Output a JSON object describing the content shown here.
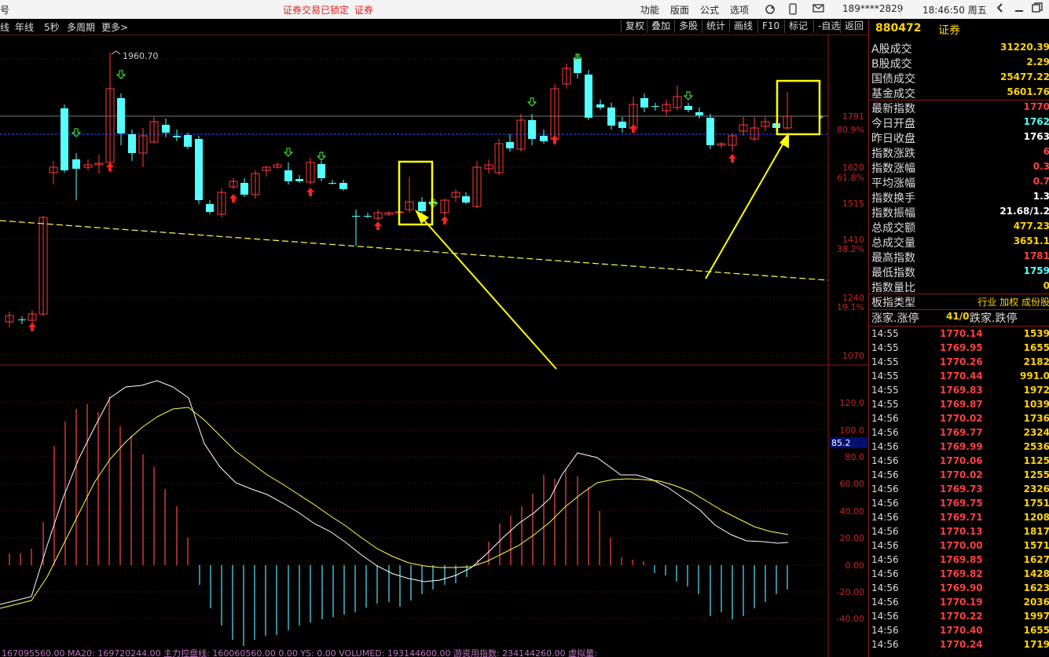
{
  "titlebar": {
    "left_glyph": "号",
    "lock_text": "证券交易已锁定",
    "lock_link": "证券",
    "menu": [
      "功能",
      "版面",
      "公式",
      "选项"
    ],
    "phone": "189****2829",
    "clock": "18:46:50 周五"
  },
  "toolbar": {
    "left": [
      "线",
      "年线",
      "5秒",
      "多周期",
      "更多>"
    ],
    "right": [
      "复权",
      "叠加",
      "多股",
      "统计",
      "画线",
      "F10",
      "标记",
      "-自选",
      "返回"
    ]
  },
  "chart": {
    "peak_label": "1960.70",
    "price_axis": [
      "1791",
      "80.9%",
      "1620",
      "61.8%",
      "1515",
      "1410",
      "38.2%",
      "1240",
      "19.1%",
      "1070"
    ],
    "macd_axis": [
      "120.0",
      "100.0",
      "80.0",
      "60.00",
      "40.00",
      "20.00",
      "0.00",
      "-20.00",
      "-40.00"
    ],
    "macd_cursor_value": "85.2",
    "status_bar": "167095560.00  MA20: 169720244.00  主力控盘线: 160060560.00  0.00  YS: 0.00  VOLUMED: 193144600.00  游资用指数: 234144260.00  虚拟量:",
    "colors": {
      "up": "#ff3a3a",
      "down": "#54ffff",
      "macd_fast": "#ffffff",
      "macd_slow": "#ffff50",
      "highlight": "#ffff00"
    }
  },
  "panel": {
    "code": "880472",
    "name": "证券",
    "stats": [
      {
        "label": "A股成交",
        "value": "31220.39",
        "color": "#ffd400"
      },
      {
        "label": "B股成交",
        "value": "2.29",
        "color": "#ffd400"
      },
      {
        "label": "国债成交",
        "value": "25477.22",
        "color": "#ffd400"
      },
      {
        "label": "基金成交",
        "value": "5601.76",
        "color": "#ffd400"
      },
      {
        "label": "最新指数",
        "value": "1770",
        "color": "#ff4040"
      },
      {
        "label": "今日开盘",
        "value": "1762",
        "color": "#54ffff"
      },
      {
        "label": "昨日收盘",
        "value": "1763",
        "color": "#ffffff"
      },
      {
        "label": "指数涨跌",
        "value": "6",
        "color": "#ff4040"
      },
      {
        "label": "指数涨幅",
        "value": "0.3",
        "color": "#ff4040"
      },
      {
        "label": "平均涨幅",
        "value": "0.7",
        "color": "#ff4040"
      },
      {
        "label": "指数换手",
        "value": "1.3",
        "color": "#ffffff"
      },
      {
        "label": "指数振幅",
        "value": "21.68/1.2",
        "color": "#ffffff"
      },
      {
        "label": "总成交额",
        "value": "477.23",
        "color": "#ffd400"
      },
      {
        "label": "总成交量",
        "value": "3651.1",
        "color": "#ffd400"
      },
      {
        "label": "最高指数",
        "value": "1781",
        "color": "#ff4040"
      },
      {
        "label": "最低指数",
        "value": "1759",
        "color": "#54ffff"
      },
      {
        "label": "指数量比",
        "value": "0",
        "color": "#ffd400"
      }
    ],
    "board_type_label": "板指类型",
    "board_type_value": "行业 加权 成份股",
    "updown_label": "涨家.涨停",
    "updown_value": "41/0",
    "down_label": "跌家.跌停",
    "ticks": [
      {
        "time": "14:55",
        "price": "1770.14",
        "vol": "1539"
      },
      {
        "time": "14:55",
        "price": "1769.95",
        "vol": "1655"
      },
      {
        "time": "14:55",
        "price": "1770.26",
        "vol": "2182"
      },
      {
        "time": "14:55",
        "price": "1770.44",
        "vol": "991.0"
      },
      {
        "time": "14:55",
        "price": "1769.83",
        "vol": "1972"
      },
      {
        "time": "14:55",
        "price": "1769.87",
        "vol": "1039"
      },
      {
        "time": "14:56",
        "price": "1770.02",
        "vol": "1736"
      },
      {
        "time": "14:56",
        "price": "1769.77",
        "vol": "2324"
      },
      {
        "time": "14:56",
        "price": "1769.99",
        "vol": "2536"
      },
      {
        "time": "14:56",
        "price": "1770.06",
        "vol": "1125"
      },
      {
        "time": "14:56",
        "price": "1770.02",
        "vol": "1255"
      },
      {
        "time": "14:56",
        "price": "1769.73",
        "vol": "2326"
      },
      {
        "time": "14:56",
        "price": "1769.75",
        "vol": "1751"
      },
      {
        "time": "14:56",
        "price": "1769.71",
        "vol": "1208"
      },
      {
        "time": "14:56",
        "price": "1770.13",
        "vol": "1817"
      },
      {
        "time": "14:56",
        "price": "1770.00",
        "vol": "1571"
      },
      {
        "time": "14:56",
        "price": "1769.85",
        "vol": "1627"
      },
      {
        "time": "14:56",
        "price": "1769.82",
        "vol": "1428"
      },
      {
        "time": "14:56",
        "price": "1769.90",
        "vol": "1623"
      },
      {
        "time": "14:56",
        "price": "1770.19",
        "vol": "2036"
      },
      {
        "time": "14:56",
        "price": "1770.22",
        "vol": "1997"
      },
      {
        "time": "14:56",
        "price": "1770.40",
        "vol": "1655"
      },
      {
        "time": "14:56",
        "price": "1770.24",
        "vol": "1719"
      }
    ]
  }
}
